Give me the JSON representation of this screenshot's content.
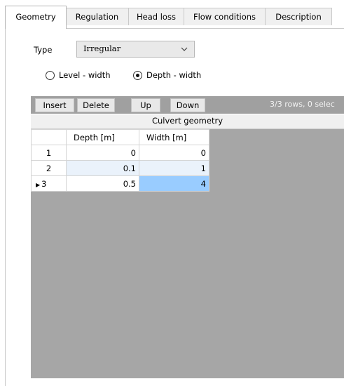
{
  "tabs": [
    {
      "label": "Geometry",
      "active": true
    },
    {
      "label": "Regulation",
      "active": false
    },
    {
      "label": "Head loss",
      "active": false
    },
    {
      "label": "Flow conditions",
      "active": false
    },
    {
      "label": "Description",
      "active": false
    }
  ],
  "geometry": {
    "type_label": "Type",
    "type_value": "Irregular",
    "radio_level_width": "Level - width",
    "radio_depth_width": "Depth - width",
    "selected_radio": "Depth - width"
  },
  "toolbar": {
    "insert": "Insert",
    "delete": "Delete",
    "up": "Up",
    "down": "Down",
    "status": "3/3 rows, 0 selec"
  },
  "grid": {
    "title": "Culvert geometry",
    "columns": [
      "Depth [m]",
      "Width [m]"
    ],
    "rows": [
      {
        "index": "1",
        "depth": "0",
        "width": "0"
      },
      {
        "index": "2",
        "depth": "0.1",
        "width": "1"
      },
      {
        "index": "3",
        "depth": "0.5",
        "width": "4",
        "current": true
      }
    ]
  },
  "colors": {
    "selected_cell": "#99ccff",
    "grid_background": "#a6a6a6",
    "toolbar_background": "#a0a0a0"
  }
}
